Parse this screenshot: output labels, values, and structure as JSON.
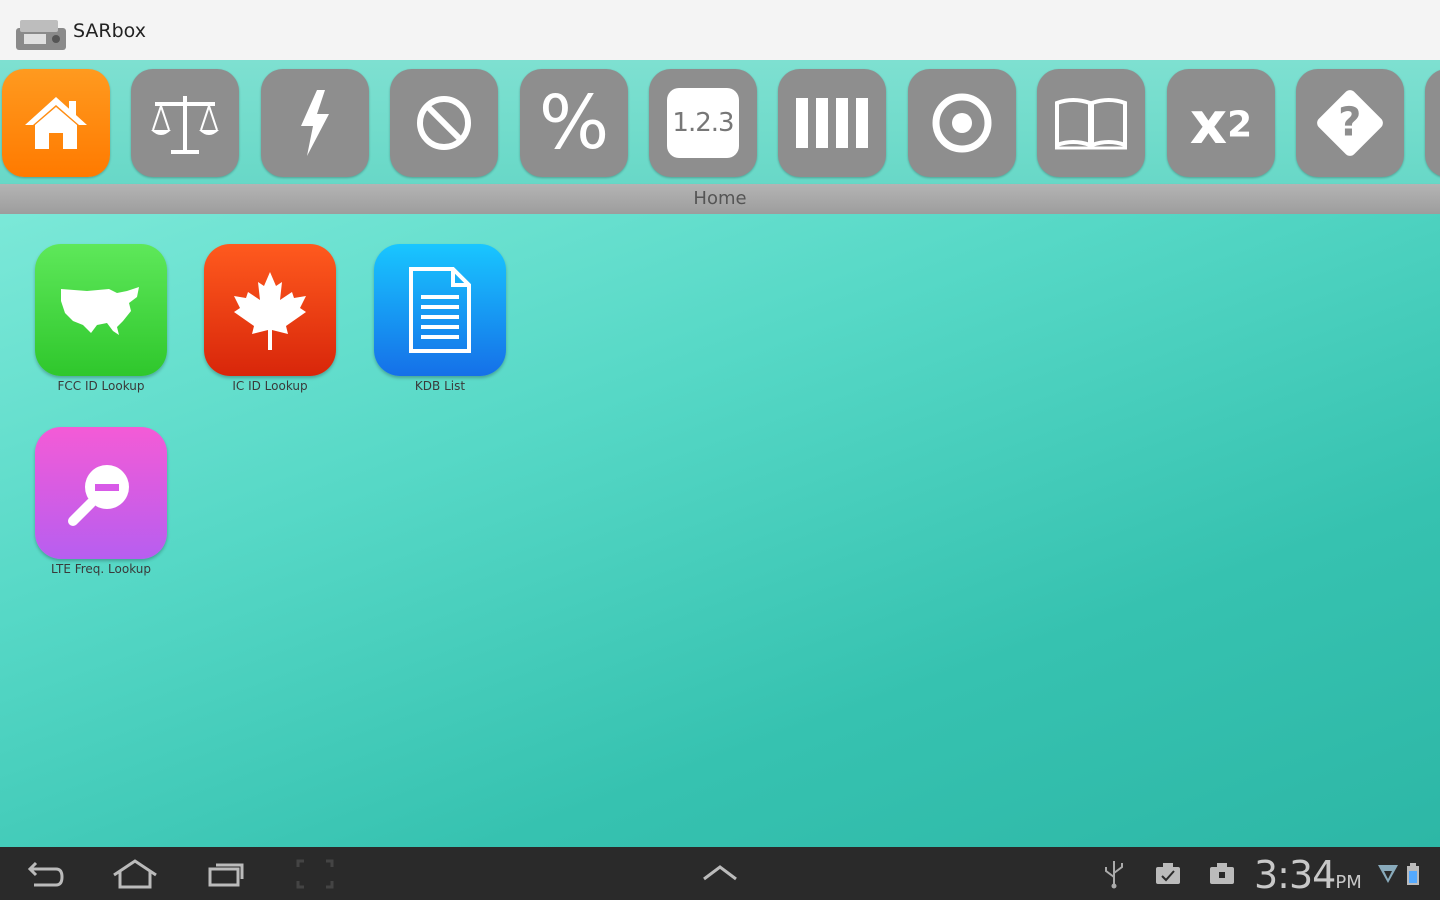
{
  "app": {
    "title": "SARbox"
  },
  "toolbar": {
    "items": [
      {
        "name": "home",
        "icon": "house-icon",
        "active": true
      },
      {
        "name": "balance",
        "icon": "scale-icon"
      },
      {
        "name": "power",
        "icon": "lightning-icon"
      },
      {
        "name": "block",
        "icon": "no-entry-icon"
      },
      {
        "name": "percent",
        "icon": "percent-icon",
        "text": "%"
      },
      {
        "name": "numbers",
        "icon": "numbers-icon",
        "text": "1.2.3"
      },
      {
        "name": "bars",
        "icon": "bars-icon"
      },
      {
        "name": "target",
        "icon": "target-icon"
      },
      {
        "name": "book",
        "icon": "book-icon"
      },
      {
        "name": "power-of",
        "icon": "superscript-icon",
        "text": "x",
        "sup": "2"
      },
      {
        "name": "help",
        "icon": "help-diamond-icon",
        "text": "?"
      }
    ]
  },
  "section": {
    "title": "Home"
  },
  "apps": [
    {
      "label": "FCC ID Lookup",
      "icon": "usa-map-icon",
      "color": "#3fd23d"
    },
    {
      "label": "IC ID Lookup",
      "icon": "maple-leaf-icon",
      "color": "#e43a0c"
    },
    {
      "label": "KDB List",
      "icon": "document-icon",
      "color": "#1793f0"
    },
    {
      "label": "LTE Freq. Lookup",
      "icon": "magnifier-icon",
      "color": "#d85ae8"
    }
  ],
  "statusbar": {
    "time": "3:34",
    "ampm": "PM"
  }
}
